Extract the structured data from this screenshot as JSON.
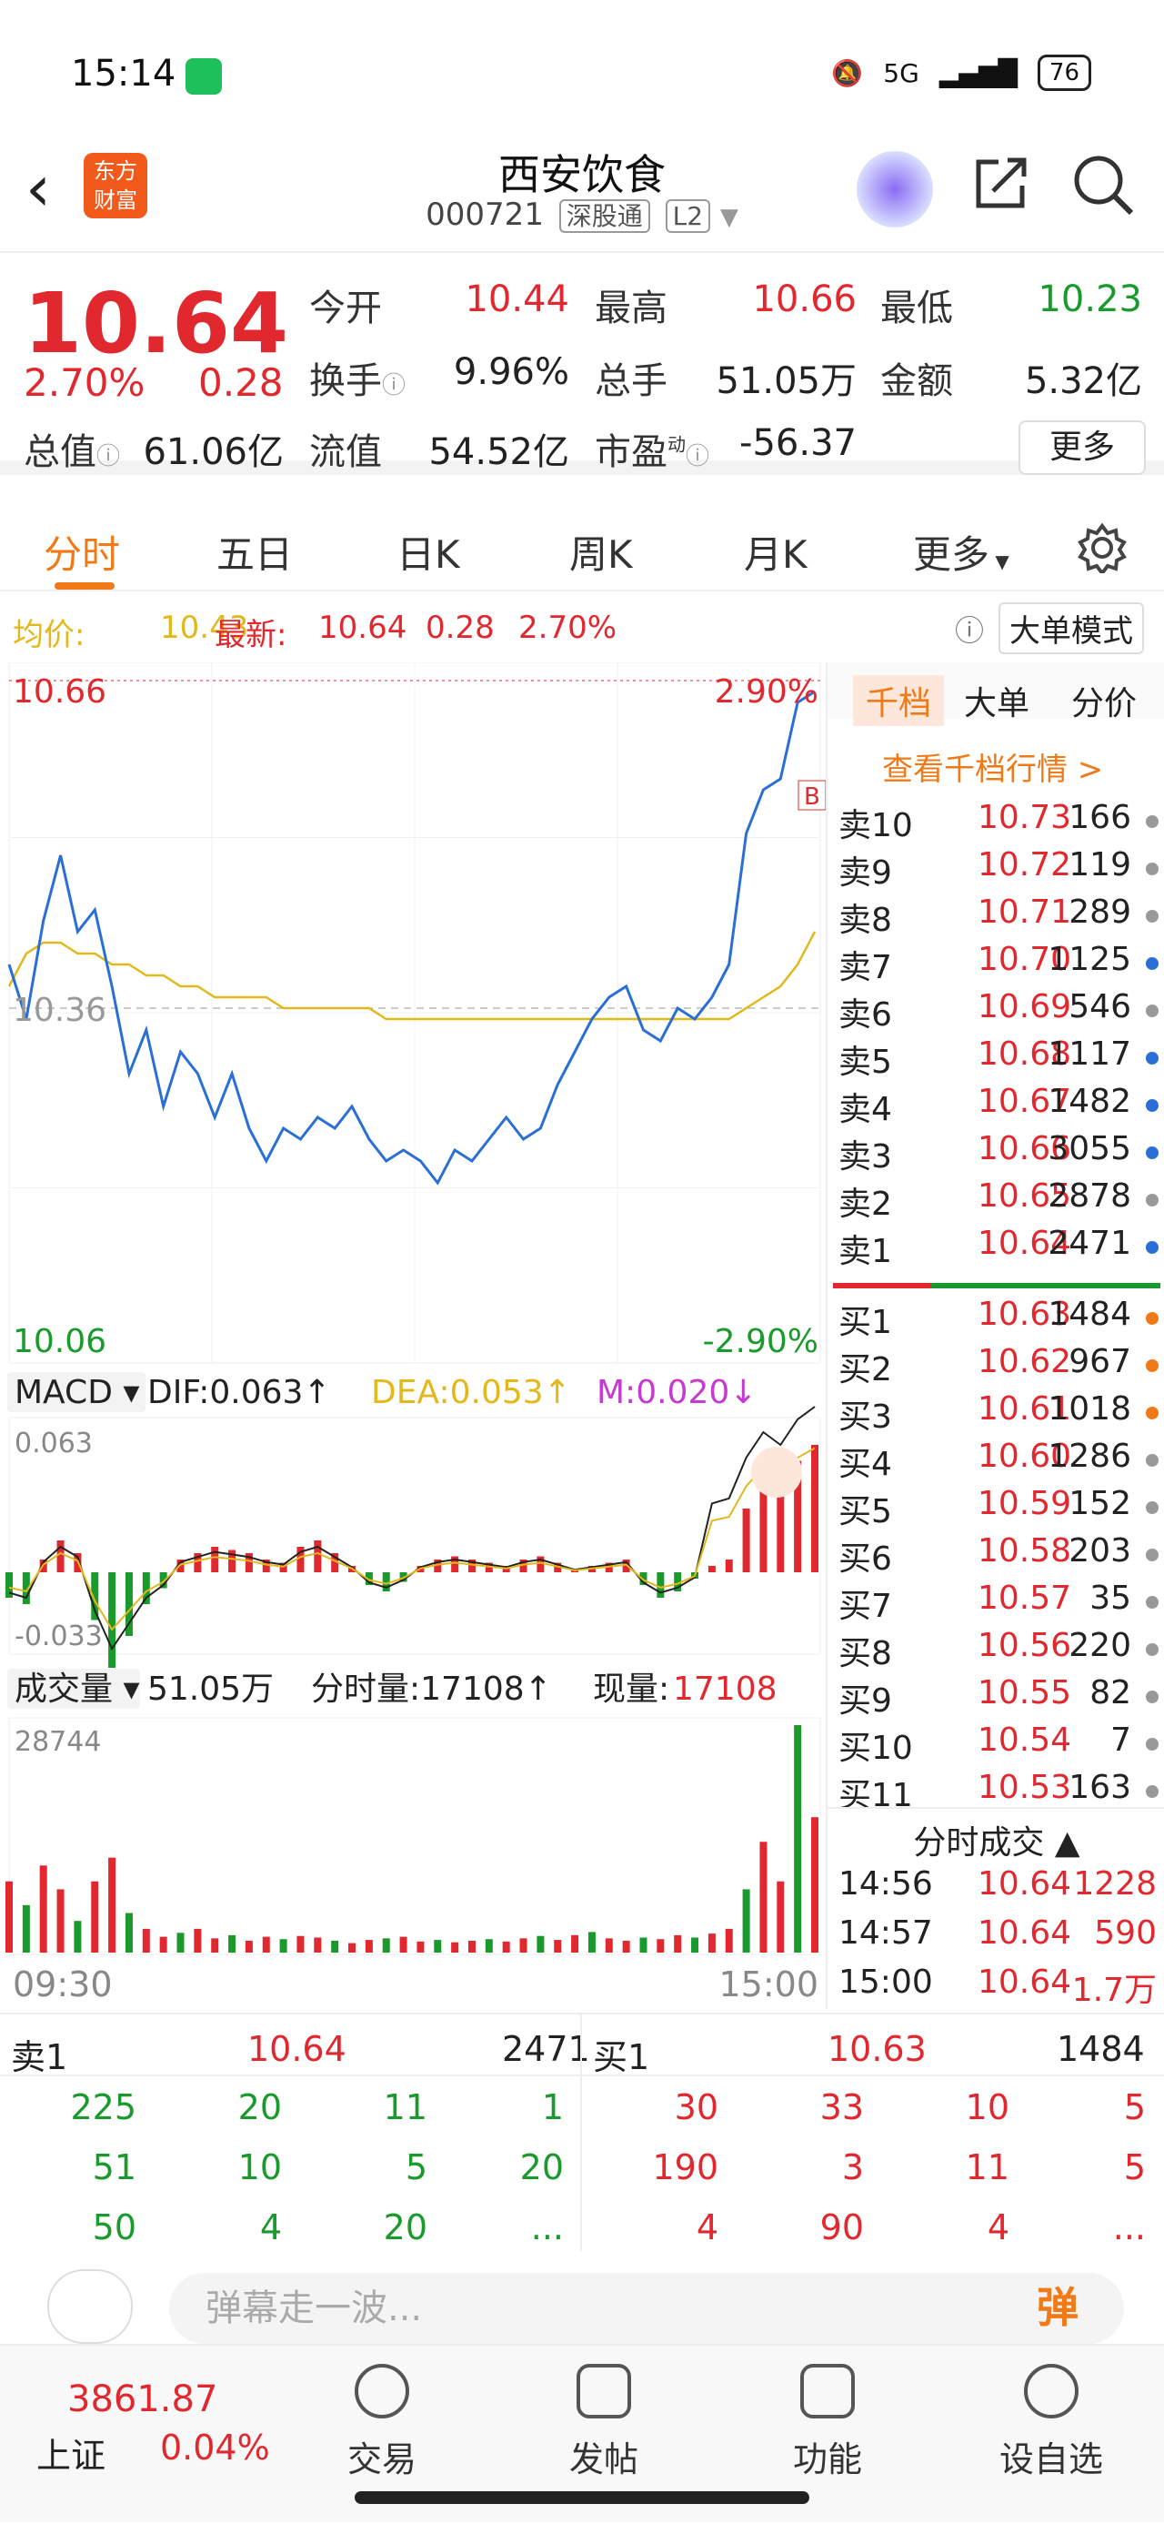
{
  "status": {
    "time": "15:14",
    "network": "5G",
    "battery": "76"
  },
  "nav": {
    "logo_text": "东方\n财富",
    "title": "西安饮食",
    "code": "000721",
    "exchange": "深股通",
    "level": "L2"
  },
  "quote": {
    "price": "10.64",
    "change_pct": "2.70%",
    "change": "0.28",
    "open_label": "今开",
    "open": "10.44",
    "high_label": "最高",
    "high": "10.66",
    "low_label": "最低",
    "low": "10.23",
    "turnover_label": "换手",
    "turnover": "9.96%",
    "volume_label": "总手",
    "volume": "51.05万",
    "amount_label": "金额",
    "amount": "5.32亿",
    "mktcap_label": "总值",
    "mktcap": "61.06亿",
    "float_label": "流值",
    "float": "54.52亿",
    "pe_label": "市盈",
    "pe_sup": "动",
    "pe": "-56.37",
    "more": "更多"
  },
  "tabs": [
    "分时",
    "五日",
    "日K",
    "周K",
    "月K",
    "更多"
  ],
  "avgbar": {
    "avg_label": "均价:",
    "avg": "10.43",
    "latest_label": "最新:",
    "latest": "10.64",
    "chg": "0.28",
    "pct": "2.70%",
    "mode": "大单模式"
  },
  "chart_data": [
    {
      "type": "line",
      "name": "intraday",
      "price_top": "10.66",
      "price_bottom": "10.06",
      "price_mid": "10.36",
      "pct_top": "2.90%",
      "pct_bottom": "-2.90%",
      "ylim": [
        10.06,
        10.66
      ],
      "x_start": "09:30",
      "x_end": "15:00",
      "series": [
        {
          "values": [
            10.4,
            10.35,
            10.44,
            10.5,
            10.43,
            10.45,
            10.38,
            10.3,
            10.34,
            10.27,
            10.32,
            10.3,
            10.26,
            10.3,
            10.25,
            10.22,
            10.25,
            10.24,
            10.26,
            10.25,
            10.27,
            10.24,
            10.22,
            10.23,
            10.22,
            10.2,
            10.23,
            10.22,
            10.24,
            10.26,
            10.24,
            10.25,
            10.29,
            10.32,
            10.35,
            10.37,
            10.38,
            10.34,
            10.33,
            10.36,
            10.35,
            10.37,
            10.4,
            10.52,
            10.56,
            10.57,
            10.64,
            10.65
          ]
        },
        {
          "values": [
            10.38,
            10.41,
            10.42,
            10.42,
            10.41,
            10.41,
            10.4,
            10.4,
            10.39,
            10.39,
            10.38,
            10.38,
            10.37,
            10.37,
            10.37,
            10.37,
            10.36,
            10.36,
            10.36,
            10.36,
            10.36,
            10.36,
            10.35,
            10.35,
            10.35,
            10.35,
            10.35,
            10.35,
            10.35,
            10.35,
            10.35,
            10.35,
            10.35,
            10.35,
            10.35,
            10.35,
            10.35,
            10.35,
            10.35,
            10.35,
            10.35,
            10.35,
            10.35,
            10.36,
            10.37,
            10.38,
            10.4,
            10.43
          ]
        }
      ]
    },
    {
      "type": "bar",
      "name": "macd",
      "title": "MACD",
      "dif": "DIF:0.063",
      "dea": "DEA:0.053",
      "m": "M:0.020",
      "ymax_label": "0.063",
      "ymin_label": "-0.033",
      "values": [
        -0.008,
        -0.01,
        0.004,
        0.01,
        0.006,
        -0.015,
        -0.03,
        -0.02,
        -0.01,
        -0.005,
        0.004,
        0.006,
        0.008,
        0.007,
        0.006,
        0.004,
        0.003,
        0.008,
        0.01,
        0.006,
        0.002,
        -0.004,
        -0.006,
        -0.003,
        0.002,
        0.004,
        0.005,
        0.004,
        0.003,
        0.002,
        0.004,
        0.005,
        0.003,
        0.001,
        0.002,
        0.003,
        0.004,
        -0.004,
        -0.008,
        -0.006,
        -0.002,
        0.002,
        0.004,
        0.02,
        0.03,
        0.025,
        0.035,
        0.04
      ]
    },
    {
      "type": "bar",
      "name": "volume",
      "title": "成交量",
      "total": "51.05万",
      "period_label": "分时量:",
      "period": "17108",
      "now_label": "现量:",
      "now": "17108",
      "ymax_label": "28744",
      "values": [
        9000,
        6000,
        11000,
        8000,
        4000,
        9000,
        12000,
        5000,
        3000,
        2000,
        2500,
        3000,
        1800,
        2200,
        1500,
        2000,
        1700,
        2100,
        1900,
        1500,
        1200,
        1600,
        1800,
        2000,
        1400,
        1600,
        1300,
        1500,
        1700,
        1400,
        1800,
        2100,
        1600,
        2200,
        2600,
        1800,
        1500,
        1900,
        1700,
        2200,
        1900,
        2400,
        3000,
        8000,
        14000,
        9000,
        28744,
        17108
      ]
    }
  ],
  "right_tabs": [
    "千档",
    "大单",
    "分价"
  ],
  "right_link": "查看千档行情 >",
  "sells": [
    {
      "n": "卖10",
      "p": "10.73",
      "v": "166",
      "c": "#999"
    },
    {
      "n": "卖9",
      "p": "10.72",
      "v": "119",
      "c": "#999"
    },
    {
      "n": "卖8",
      "p": "10.71",
      "v": "289",
      "c": "#999"
    },
    {
      "n": "卖7",
      "p": "10.70",
      "v": "1125",
      "c": "#2a6fd6"
    },
    {
      "n": "卖6",
      "p": "10.69",
      "v": "546",
      "c": "#999"
    },
    {
      "n": "卖5",
      "p": "10.68",
      "v": "1117",
      "c": "#2a6fd6"
    },
    {
      "n": "卖4",
      "p": "10.67",
      "v": "1482",
      "c": "#2a6fd6"
    },
    {
      "n": "卖3",
      "p": "10.66",
      "v": "3055",
      "c": "#2a6fd6"
    },
    {
      "n": "卖2",
      "p": "10.65",
      "v": "2878",
      "c": "#999"
    },
    {
      "n": "卖1",
      "p": "10.64",
      "v": "2471",
      "c": "#2a6fd6"
    }
  ],
  "buys": [
    {
      "n": "买1",
      "p": "10.63",
      "v": "1484",
      "c": "#f07a18"
    },
    {
      "n": "买2",
      "p": "10.62",
      "v": "967",
      "c": "#f07a18"
    },
    {
      "n": "买3",
      "p": "10.61",
      "v": "1018",
      "c": "#f07a18"
    },
    {
      "n": "买4",
      "p": "10.60",
      "v": "1286",
      "c": "#999"
    },
    {
      "n": "买5",
      "p": "10.59",
      "v": "152",
      "c": "#999"
    },
    {
      "n": "买6",
      "p": "10.58",
      "v": "203",
      "c": "#999"
    },
    {
      "n": "买7",
      "p": "10.57",
      "v": "35",
      "c": "#999"
    },
    {
      "n": "买8",
      "p": "10.56",
      "v": "220",
      "c": "#999"
    },
    {
      "n": "买9",
      "p": "10.55",
      "v": "82",
      "c": "#999"
    },
    {
      "n": "买10",
      "p": "10.54",
      "v": "7",
      "c": "#999"
    },
    {
      "n": "买11",
      "p": "10.53",
      "v": "163",
      "c": "#999"
    }
  ],
  "ticks_title": "分时成交",
  "ticks": [
    {
      "t": "14:56",
      "p": "10.64",
      "v": "1228"
    },
    {
      "t": "14:57",
      "p": "10.64",
      "v": "590"
    },
    {
      "t": "15:00",
      "p": "10.64",
      "v": "1.7万"
    }
  ],
  "bottom_book": {
    "sell_label": "卖1",
    "sell_price": "10.64",
    "sell_vol": "2471",
    "buy_label": "买1",
    "buy_price": "10.63",
    "buy_vol": "1484",
    "sell_rows": [
      [
        "225",
        "20",
        "11",
        "1"
      ],
      [
        "51",
        "10",
        "5",
        "20"
      ],
      [
        "50",
        "4",
        "20",
        "..."
      ]
    ],
    "buy_rows": [
      [
        "30",
        "33",
        "10",
        "5"
      ],
      [
        "190",
        "3",
        "11",
        "5"
      ],
      [
        "4",
        "90",
        "4",
        "..."
      ]
    ]
  },
  "danmu": {
    "placeholder": "弹幕走一波...",
    "btn": "弹"
  },
  "footer": {
    "index_value": "3861.87",
    "index_name": "上证",
    "index_pct": "0.04%",
    "items": [
      "交易",
      "发帖",
      "功能",
      "设自选"
    ]
  }
}
